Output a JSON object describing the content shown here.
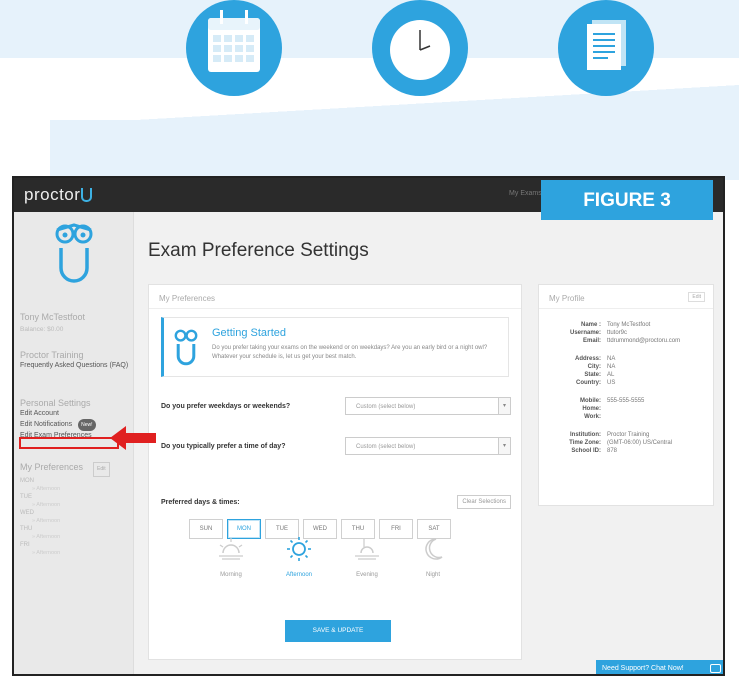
{
  "figure_label": "FIGURE 3",
  "app": {
    "logo_text": "proctor",
    "topnav": "My Exams    My"
  },
  "page": {
    "title": "Exam Preference Settings"
  },
  "sidebar": {
    "user_name": "Tony McTestfoot",
    "balance": "Balance: $0.00",
    "training_title": "Proctor Training",
    "training_link": "Frequently Asked Questions (FAQ)",
    "settings_title": "Personal Settings",
    "edit_account": "Edit Account",
    "edit_notifications": "Edit Notifications",
    "notifications_badge": "New!",
    "edit_exam_prefs": "Edit Exam Preferences",
    "prefs_title": "My Preferences",
    "prefs_edit": "Edit",
    "prefs": [
      {
        "day": "MON",
        "time": "» Afternoon"
      },
      {
        "day": "TUE",
        "time": "» Afternoon"
      },
      {
        "day": "WED",
        "time": "» Afternoon"
      },
      {
        "day": "THU",
        "time": "» Afternoon"
      },
      {
        "day": "FRI",
        "time": "» Afternoon"
      }
    ]
  },
  "prefs_panel": {
    "title": "My Preferences",
    "getting_started_title": "Getting Started",
    "getting_started_text": "Do you prefer taking your exams on the weekend or on weekdays? Are you an early bird or a night owl? Whatever your schedule is, let us get your best match.",
    "q1": "Do you prefer weekdays or weekends?",
    "q1_value": "Custom (select below)",
    "q2": "Do you typically prefer a time of day?",
    "q2_value": "Custom (select below)",
    "days_label": "Preferred days & times:",
    "clear_label": "Clear Selections",
    "days": [
      "SUN",
      "MON",
      "TUE",
      "WED",
      "THU",
      "FRI",
      "SAT"
    ],
    "selected_day": "MON",
    "times": [
      "Morning",
      "Afternoon",
      "Evening",
      "Night"
    ],
    "selected_time": "Afternoon",
    "save_label": "SAVE & UPDATE"
  },
  "profile": {
    "title": "My Profile",
    "edit": "Edit",
    "rows": [
      {
        "k": "Name :",
        "v": "Tony McTestfoot"
      },
      {
        "k": "Username:",
        "v": "ttutor9c"
      },
      {
        "k": "Email:",
        "v": "ttdrummond@proctoru.com"
      },
      {
        "k": "Address:",
        "v": "NA"
      },
      {
        "k": "City:",
        "v": "NA"
      },
      {
        "k": "State:",
        "v": "AL"
      },
      {
        "k": "Country:",
        "v": "US"
      },
      {
        "k": "Mobile:",
        "v": "555-555-5555"
      },
      {
        "k": "Home:",
        "v": ""
      },
      {
        "k": "Work:",
        "v": ""
      },
      {
        "k": "Institution:",
        "v": "Proctor Training"
      },
      {
        "k": "Time Zone:",
        "v": "(GMT-06:00) US/Central"
      },
      {
        "k": "School ID:",
        "v": "878"
      }
    ]
  },
  "chat_label": "Need Support? Chat Now!",
  "colors": {
    "accent": "#2ea3de",
    "highlight": "#e02020"
  }
}
